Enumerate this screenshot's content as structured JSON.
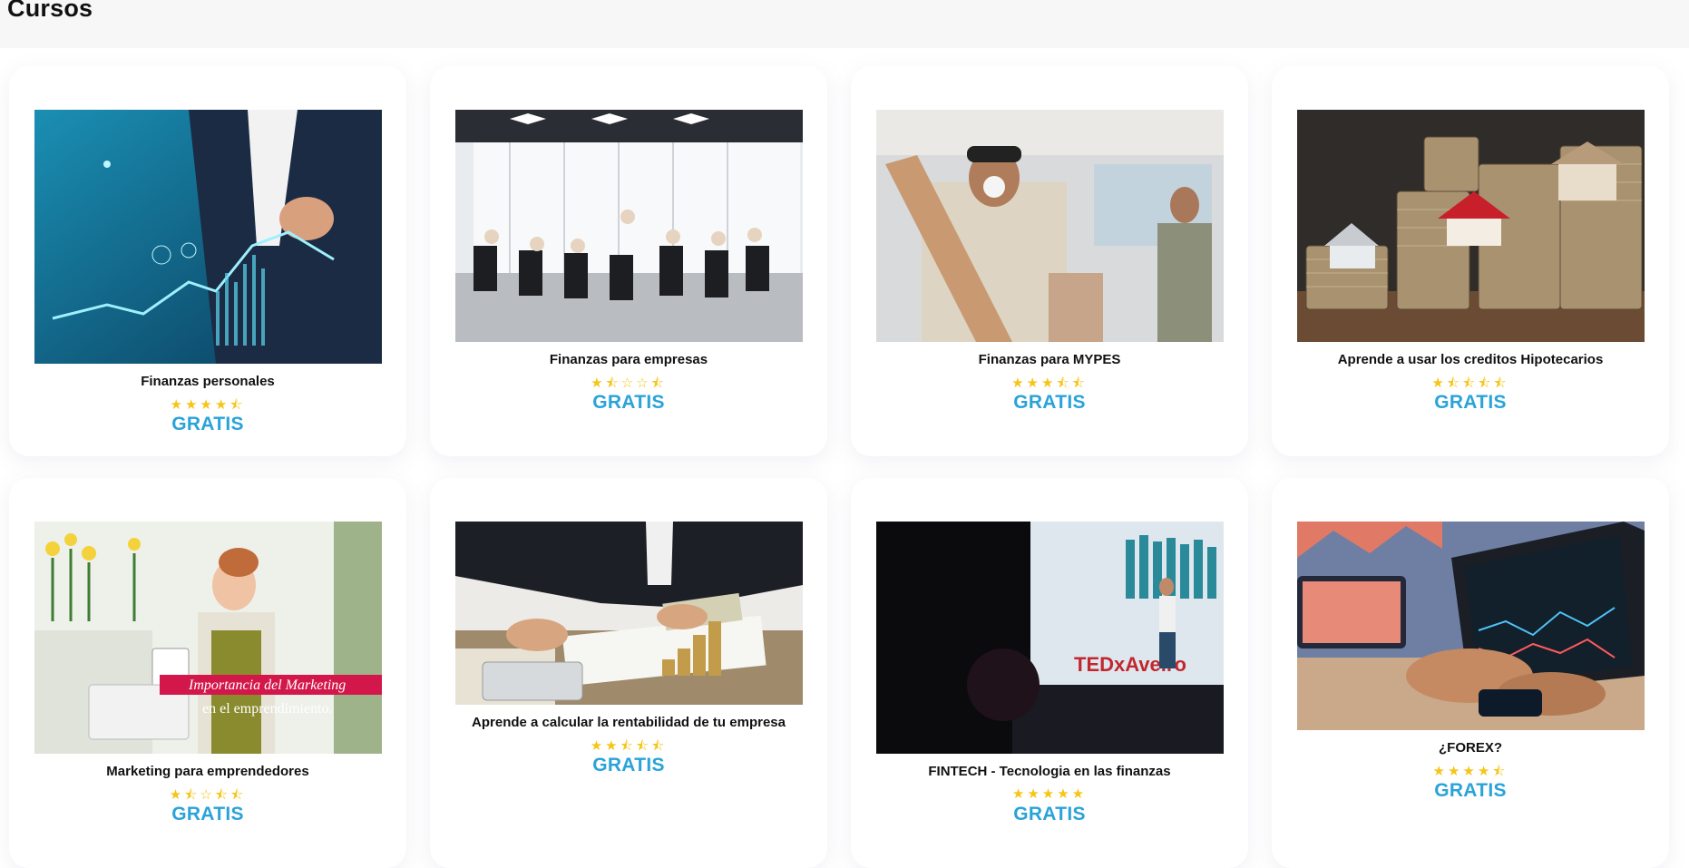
{
  "header": {
    "title": "Cursos"
  },
  "courses": [
    {
      "title": "Finanzas personales",
      "rating": 4.5,
      "stars": "★★★★⯪",
      "price": "GRATIS",
      "image": "finance-chart-photo"
    },
    {
      "title": "Finanzas para empresas",
      "rating": 2.5,
      "stars": "★⯪☆☆⯪",
      "price": "GRATIS",
      "image": "meeting-room-photo"
    },
    {
      "title": "Finanzas para MYPES",
      "rating": 3.5,
      "stars": "★★★⯪⯪",
      "price": "GRATIS",
      "image": "workshop-photo"
    },
    {
      "title": "Aprende a usar los creditos Hipotecarios",
      "rating": 2.5,
      "stars": "★⯪⯪⯪⯪",
      "price": "GRATIS",
      "image": "houses-coins-photo"
    },
    {
      "title": "Marketing para emprendedores",
      "rating": 1.5,
      "stars": "★⯪☆⯪⯪",
      "price": "GRATIS",
      "image": "flower-shop-photo",
      "image_text": [
        "Importancia del Marketing",
        "en el emprendimiento."
      ]
    },
    {
      "title": "Aprende a calcular la rentabilidad de tu empresa",
      "rating": 2.5,
      "stars": "★★⯪⯪⯪",
      "price": "GRATIS",
      "image": "calculator-money-photo"
    },
    {
      "title": "FINTECH - Tecnologia en las finanzas",
      "rating": 5,
      "stars": "★★★★★",
      "price": "GRATIS",
      "image": "tedx-stage-photo",
      "image_text": [
        "TEDxAveiro"
      ]
    },
    {
      "title": "¿FOREX?",
      "rating": 4.5,
      "stars": "★★★★⯪",
      "price": "GRATIS",
      "image": "trading-laptop-photo"
    }
  ]
}
